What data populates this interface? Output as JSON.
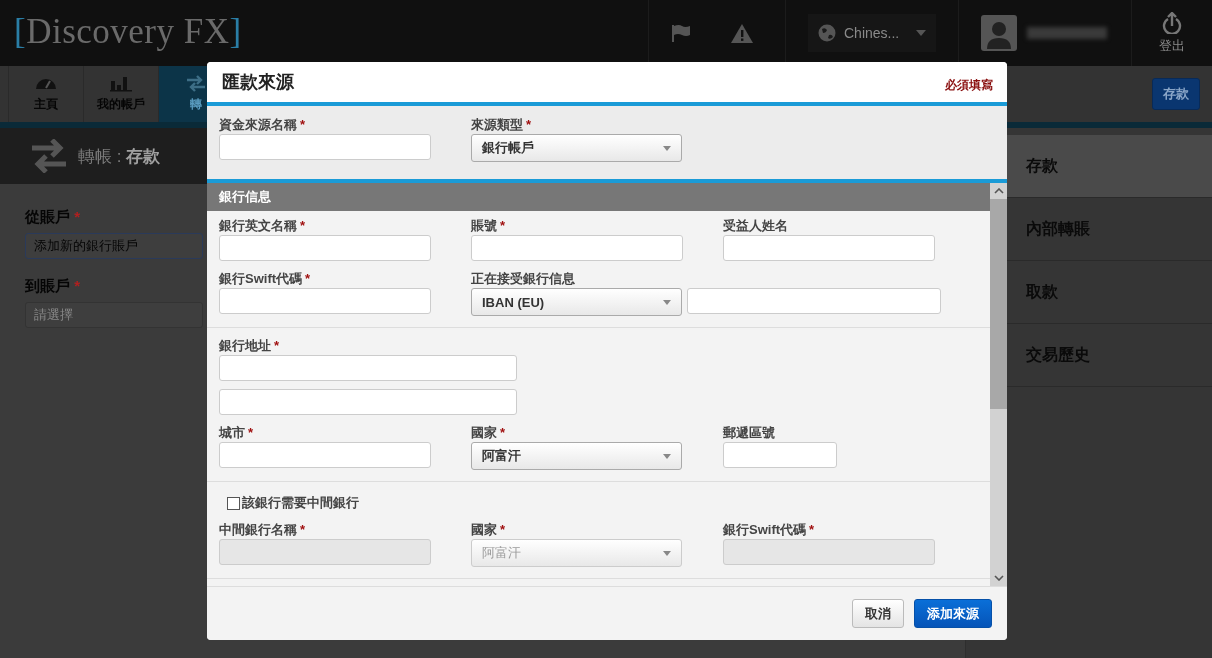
{
  "header": {
    "logo": "[Discovery FX]",
    "language": "Chines...",
    "logout": "登出"
  },
  "nav": {
    "tabs": [
      {
        "label": "主頁",
        "selected": false
      },
      {
        "label": "我的帳戶",
        "selected": false
      },
      {
        "label": "轉",
        "selected": true
      }
    ],
    "action_button": "存款"
  },
  "page_title": "轉帳 : **存款**",
  "form": {
    "fields": [
      {
        "label": "從賬戶",
        "mark": "*",
        "value": "添加新的銀行賬戶"
      },
      {
        "label": "到賬戶",
        "mark": "*",
        "placeholder": "請選擇"
      }
    ]
  },
  "sidebar": {
    "items": [
      {
        "label": "存款",
        "selected": true
      },
      {
        "label": "內部轉賬",
        "selected": false
      },
      {
        "label": "取款",
        "selected": false
      },
      {
        "label": "交易歷史",
        "selected": false
      }
    ]
  },
  "modal": {
    "title": "匯款來源",
    "required_note": "必須填寫",
    "top_fields": [
      {
        "label": "資金來源名稱",
        "mark": "*",
        "kind": "input",
        "disabled": false
      },
      {
        "label": "來源類型",
        "mark": "*",
        "kind": "select",
        "value": "銀行帳戶",
        "disabled": false
      }
    ],
    "section_title": "銀行信息",
    "groups": [
      {
        "rows": [
          [
            {
              "label": "銀行英文名稱",
              "mark": "*",
              "kind": "input",
              "disabled": false
            },
            {
              "label": "賬號",
              "mark": "*",
              "kind": "input",
              "disabled": false
            },
            {
              "label": "受益人姓名",
              "kind": "input",
              "disabled": false
            }
          ],
          [
            {
              "label": "銀行Swift代碼",
              "mark": "*",
              "kind": "input",
              "disabled": false
            },
            {
              "label": "正在接受銀行信息",
              "kind": "pair",
              "value": "IBAN (EU)",
              "disabled": false
            }
          ]
        ]
      },
      {
        "rows": [
          [
            {
              "label": "銀行地址",
              "mark": "*",
              "kind": "double",
              "disabled": false
            }
          ],
          [
            {
              "label": "城市",
              "mark": "*",
              "kind": "input",
              "disabled": false
            },
            {
              "label": "國家",
              "mark": "*",
              "kind": "select",
              "value": "阿富汗",
              "disabled": false
            },
            {
              "label": "郵遞區號",
              "kind": "short",
              "disabled": false
            }
          ]
        ]
      },
      {
        "checkbox": {
          "label": "該銀行需要中間銀行",
          "checked": false
        },
        "rows": [
          [
            {
              "label": "中間銀行名稱",
              "mark": "*",
              "kind": "input",
              "disabled": true
            },
            {
              "label": "國家",
              "mark": "*",
              "kind": "select",
              "value": "阿富汗",
              "disabled": true
            },
            {
              "label": "銀行Swift代碼",
              "mark": "*",
              "kind": "input",
              "disabled": true
            }
          ]
        ]
      }
    ],
    "buttons": [
      {
        "label": "取消",
        "kind": "secondary"
      },
      {
        "label": "添加來源",
        "kind": "primary"
      }
    ]
  }
}
